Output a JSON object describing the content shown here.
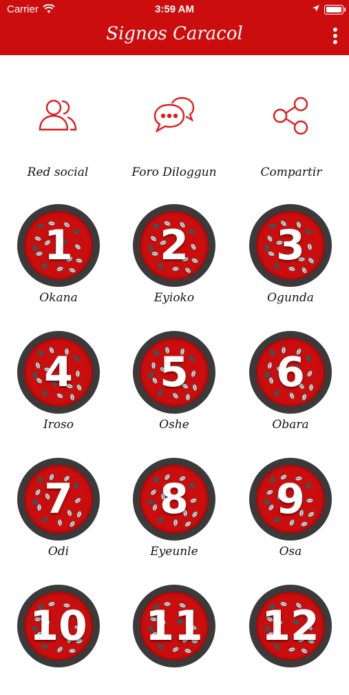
{
  "status": {
    "carrier": "Carrier",
    "time": "3:59 AM"
  },
  "header": {
    "title": "Signos Caracol",
    "accent": "#cc0d0d"
  },
  "quick_actions": [
    {
      "label": "Red social",
      "icon": "users-icon"
    },
    {
      "label": "Foro Diloggun",
      "icon": "chat-bubbles-icon"
    },
    {
      "label": "Compartir",
      "icon": "share-icon"
    }
  ],
  "signs": [
    {
      "number": "1",
      "name": "Okana"
    },
    {
      "number": "2",
      "name": "Eyioko"
    },
    {
      "number": "3",
      "name": "Ogunda"
    },
    {
      "number": "4",
      "name": "Iroso"
    },
    {
      "number": "5",
      "name": "Oshe"
    },
    {
      "number": "6",
      "name": "Obara"
    },
    {
      "number": "7",
      "name": "Odi"
    },
    {
      "number": "8",
      "name": "Eyeunle"
    },
    {
      "number": "9",
      "name": "Osa"
    },
    {
      "number": "10",
      "name": ""
    },
    {
      "number": "11",
      "name": ""
    },
    {
      "number": "12",
      "name": ""
    }
  ]
}
